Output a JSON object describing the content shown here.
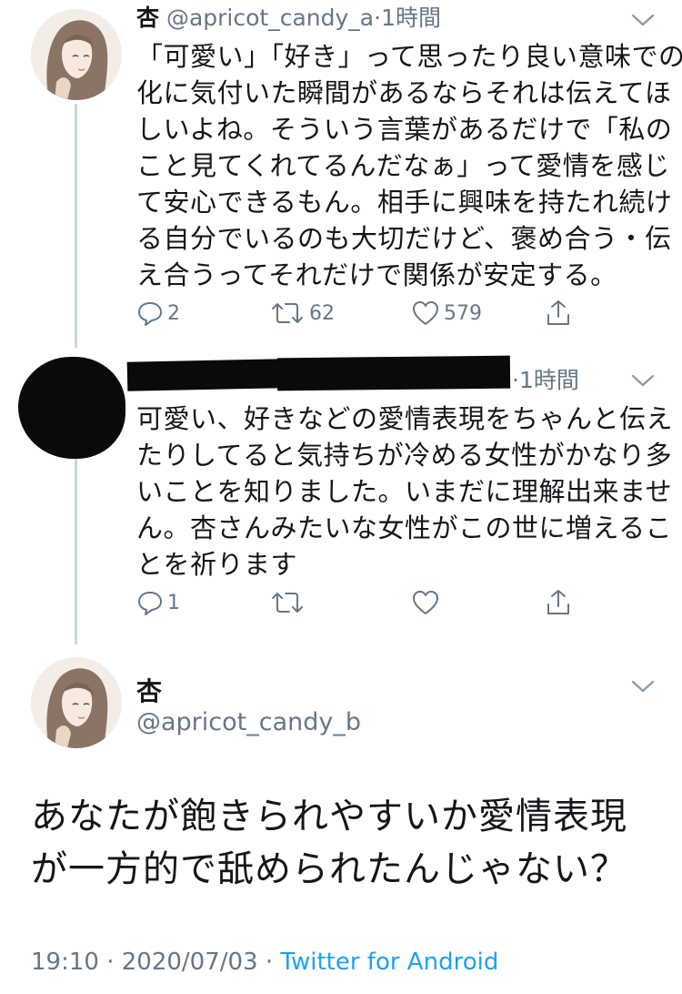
{
  "tweet1": {
    "name": "杏",
    "handle": "@apricot_candy_a",
    "separator": "·",
    "time": "1時間",
    "lines": [
      "「可愛い」「好き」って思ったり良い意味での変",
      "化に気付いた瞬間があるならそれは伝えてほ",
      "しいよね。そういう言葉があるだけで「私の",
      "こと見てくれてるんだなぁ」って愛情を感じ",
      "て安心できるもん。相手に興味を持たれ続け",
      "る自分でいるのも大切だけど、褒め合う・伝",
      "え合うってそれだけで関係が安定する。"
    ],
    "replies": "2",
    "retweets": "62",
    "likes": "579"
  },
  "tweet2": {
    "separator": "·",
    "time": "1時間",
    "lines": [
      "可愛い、好きなどの愛情表現をちゃんと伝え",
      "たりしてると気持ちが冷める女性がかなり多",
      "いことを知りました。いまだに理解出来ませ",
      "ん。杏さんみたいな女性がこの世に増えるこ",
      "とを祈ります"
    ],
    "replies": "1"
  },
  "tweet3": {
    "name": "杏",
    "handle": "@apricot_candy_b",
    "lines": [
      "あなたが飽きられやすいか愛情表現",
      "が一方的で舐められたんじゃない？"
    ],
    "time": "19:10",
    "sep1": "·",
    "date": "2020/07/03",
    "sep2": "·",
    "source": "Twitter for Android"
  },
  "colors": {
    "text": "#14171a",
    "secondary": "#657786",
    "link": "#1da1f2",
    "thread_line": "#ccd6dd"
  },
  "icons": [
    "reply-icon",
    "retweet-icon",
    "like-icon",
    "share-icon",
    "chevron-down-icon"
  ]
}
